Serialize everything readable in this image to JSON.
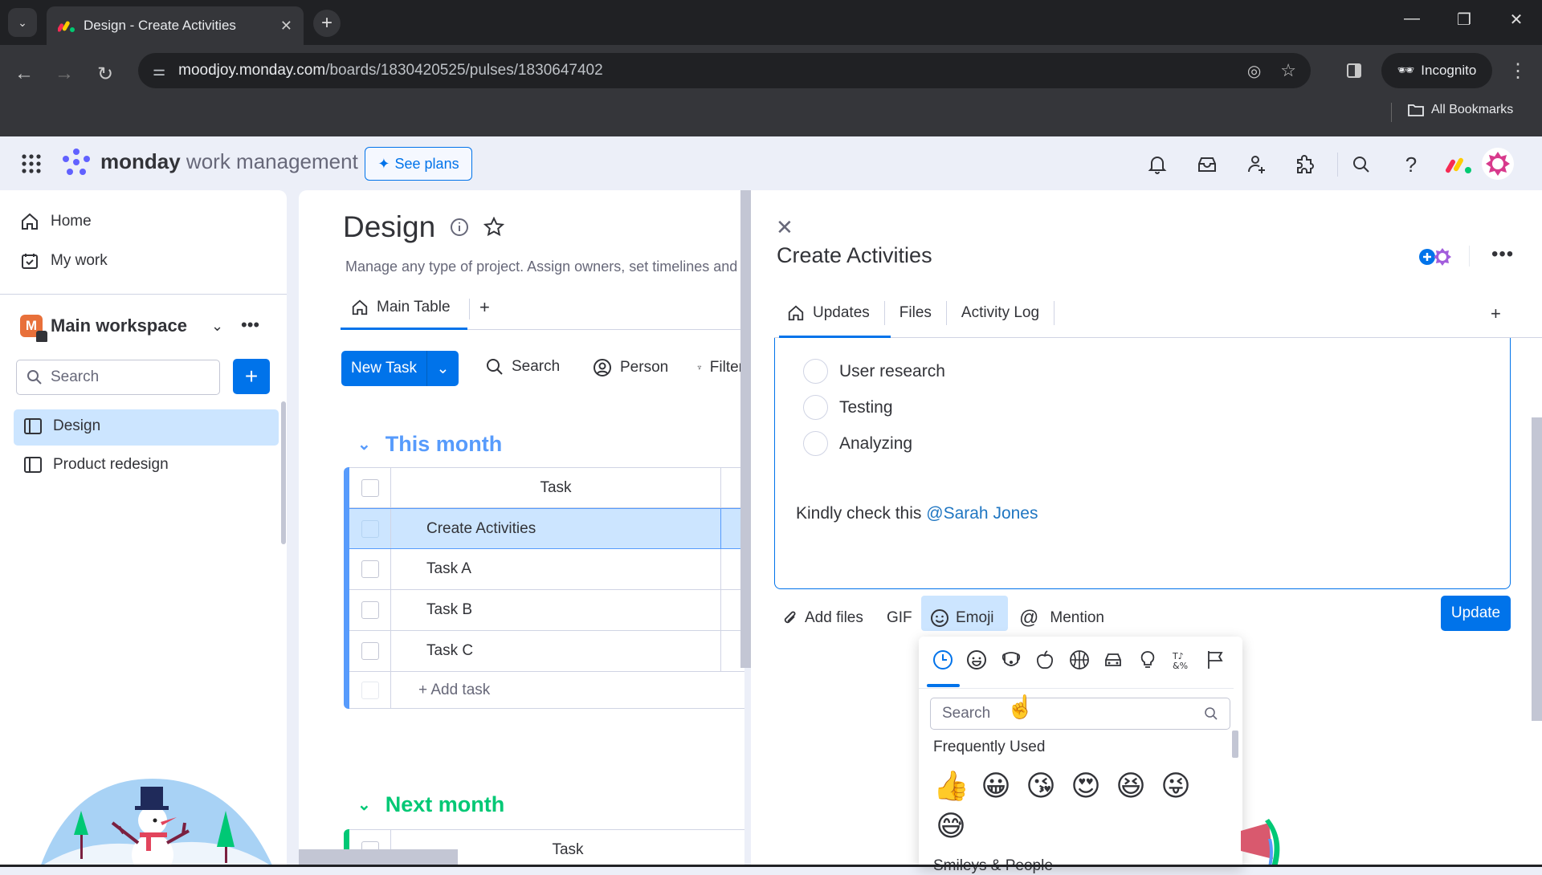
{
  "browser": {
    "tab_title": "Design - Create Activities",
    "url_host": "moodjoy.monday.com",
    "url_path": "/boards/1830420525/pulses/1830647402",
    "incognito_label": "Incognito",
    "bookmarks_label": "All Bookmarks"
  },
  "app": {
    "brand": "monday",
    "brand_suffix": "work management",
    "see_plans": "See plans",
    "header_icons": [
      "bell-icon",
      "inbox-icon",
      "invite-members-icon",
      "apps-icon",
      "search-icon",
      "help-icon",
      "monday-logo-icon",
      "avatar-icon"
    ]
  },
  "sidebar": {
    "nav": [
      {
        "label": "Home",
        "icon": "home-icon"
      },
      {
        "label": "My work",
        "icon": "my-work-icon"
      }
    ],
    "workspace": {
      "badge": "M",
      "name": "Main workspace"
    },
    "search_placeholder": "Search",
    "boards": [
      {
        "label": "Design",
        "selected": true
      },
      {
        "label": "Product redesign",
        "selected": false
      }
    ]
  },
  "board": {
    "title": "Design",
    "description": "Manage any type of project. Assign owners, set timelines and keep track of where your project stands.",
    "tabs": [
      {
        "label": "Main Table",
        "active": true
      }
    ],
    "toolbar": {
      "new_task": "New Task",
      "search": "Search",
      "person": "Person",
      "filter": "Filter"
    },
    "groups": [
      {
        "name": "This month",
        "color": "#579bfc",
        "column_header": "Task",
        "rows": [
          "Create Activities",
          "Task A",
          "Task B",
          "Task C"
        ],
        "selected_row": "Create Activities",
        "add_label": "+ Add task"
      },
      {
        "name": "Next month",
        "color": "#00c875",
        "column_header": "Task",
        "rows": []
      }
    ]
  },
  "panel": {
    "title": "Create Activities",
    "tabs": [
      {
        "label": "Updates",
        "active": true
      },
      {
        "label": "Files",
        "active": false
      },
      {
        "label": "Activity Log",
        "active": false
      }
    ],
    "checklist": [
      {
        "label": "User research",
        "checked": false
      },
      {
        "label": "Testing",
        "checked": false
      },
      {
        "label": "Analyzing",
        "checked": false
      }
    ],
    "message_prefix": "Kindly check this ",
    "mention": "@Sarah Jones",
    "tools": {
      "add_files": "Add files",
      "gif": "GIF",
      "emoji": "Emoji",
      "mention": "Mention"
    },
    "update_button": "Update"
  },
  "emoji_picker": {
    "categories": [
      "recent",
      "smileys",
      "animals",
      "food",
      "activity",
      "travel",
      "objects",
      "symbols",
      "flags"
    ],
    "active_category": "recent",
    "search_placeholder": "Search",
    "frequently_used_label": "Frequently Used",
    "frequently_used": [
      "👍",
      "😀",
      "😘",
      "😍",
      "😆",
      "😜",
      "😅"
    ],
    "next_section_label": "Smileys & People"
  }
}
